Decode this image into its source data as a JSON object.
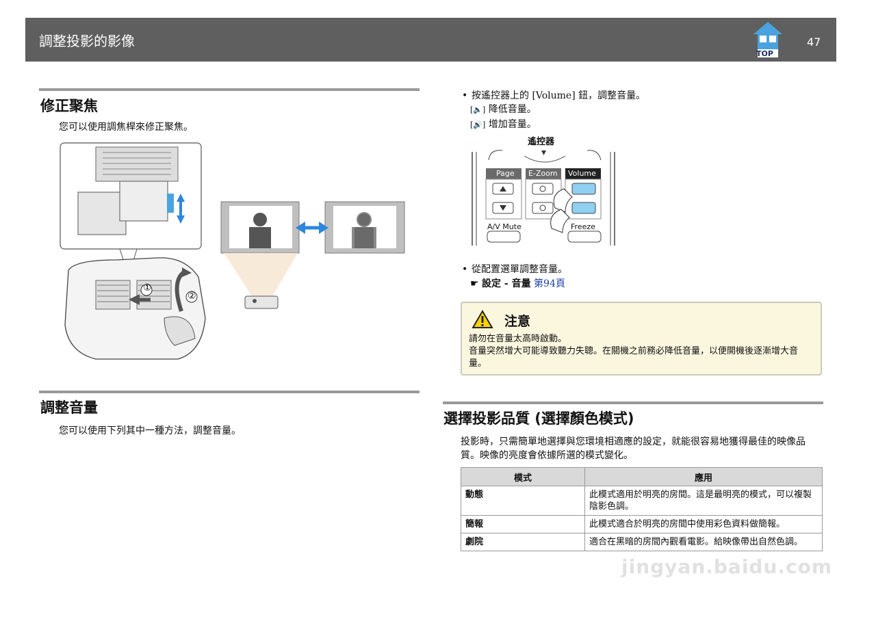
{
  "header": {
    "title": "調整投影的影像",
    "top_label": "TOP",
    "page_number": "47"
  },
  "focus_section": {
    "title": "修正聚焦",
    "text": "您可以使用調焦桿來修正聚焦。",
    "markers": [
      "①",
      "②"
    ]
  },
  "volume_section": {
    "title": "調整音量",
    "text": "您可以使用下列其中一種方法，調整音量。",
    "bullet1": "按遙控器上的 [Volume] 鈕，調整音量。",
    "down_icon": "[🔈]",
    "down_text": "降低音量。",
    "up_icon": "[🔊]",
    "up_text": "增加音量。",
    "remote_label": "遙控器",
    "remote_buttons": {
      "page": "Page",
      "ezoom": "E-Zoom",
      "volume": "Volume",
      "av_mute": "A/V Mute",
      "freeze": "Freeze"
    },
    "bullet2": "從配置選單調整音量。",
    "menu_path_prefix": "☛",
    "menu_path": "設定 - 音量",
    "menu_link": "第94頁"
  },
  "caution": {
    "title": "注意",
    "line1": "請勿在音量太高時啟動。",
    "line2": "音量突然增大可能導致聽力失聰。在關機之前務必降低音量，以便開機後逐漸增大音量。"
  },
  "quality_section": {
    "title": "選擇投影品質 (選擇顏色模式)",
    "text": "投影時，只需簡單地選擇與您環境相適應的設定，就能很容易地獲得最佳的映像品質。映像的亮度會依據所選的模式變化。",
    "table": {
      "headers": [
        "模式",
        "應用"
      ],
      "rows": [
        {
          "mode": "動態",
          "use": "此模式適用於明亮的房間。這是最明亮的模式，可以複製陰影色調。"
        },
        {
          "mode": "簡報",
          "use": "此模式適合於明亮的房間中使用彩色資料做簡報。"
        },
        {
          "mode": "劇院",
          "use": "適合在黑暗的房間內觀看電影。給映像帶出自然色調。"
        }
      ]
    }
  },
  "watermark": "jingyan.baidu.com"
}
